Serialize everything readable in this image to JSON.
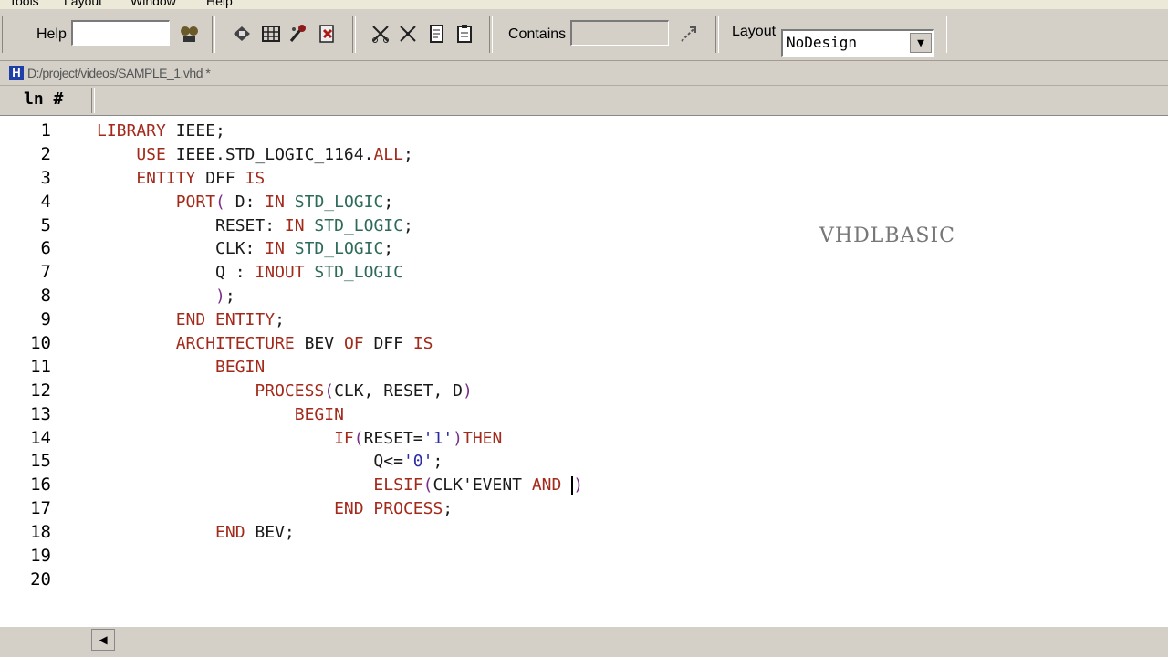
{
  "menu": [
    "Tools",
    "Layout",
    "Window",
    "Help"
  ],
  "toolbar": {
    "help_label": "Help",
    "help_value": "",
    "contains_label": "Contains",
    "contains_value": "",
    "layout_label": "Layout",
    "layout_value": "NoDesign"
  },
  "document": {
    "path": "D:/project/videos/SAMPLE_1.vhd *"
  },
  "ruler": {
    "ln_label": "ln #"
  },
  "line_numbers": [
    "1",
    "2",
    "3",
    "4",
    "5",
    "6",
    "7",
    "8",
    "9",
    "10",
    "11",
    "12",
    "13",
    "14",
    "15",
    "16",
    "17",
    "18",
    "19",
    "20"
  ],
  "code": [
    [
      {
        "t": "LIBRARY",
        "c": "kw"
      },
      {
        "t": " IEEE;",
        "c": "id"
      }
    ],
    [
      {
        "t": "    USE",
        "c": "kw"
      },
      {
        "t": " IEEE.STD_LOGIC_1164.",
        "c": "id"
      },
      {
        "t": "ALL",
        "c": "kw"
      },
      {
        "t": ";",
        "c": "id"
      }
    ],
    [
      {
        "t": "    ENTITY",
        "c": "kw"
      },
      {
        "t": " DFF ",
        "c": "id"
      },
      {
        "t": "IS",
        "c": "kw"
      }
    ],
    [
      {
        "t": "        PORT",
        "c": "kw"
      },
      {
        "t": "(",
        "c": "pn"
      },
      {
        "t": " D: ",
        "c": "id"
      },
      {
        "t": "IN",
        "c": "kw"
      },
      {
        "t": " STD_LOGIC",
        "c": "tp"
      },
      {
        "t": ";",
        "c": "id"
      }
    ],
    [
      {
        "t": "            RESET: ",
        "c": "id"
      },
      {
        "t": "IN",
        "c": "kw"
      },
      {
        "t": " STD_LOGIC",
        "c": "tp"
      },
      {
        "t": ";",
        "c": "id"
      }
    ],
    [
      {
        "t": "            CLK: ",
        "c": "id"
      },
      {
        "t": "IN",
        "c": "kw"
      },
      {
        "t": " STD_LOGIC",
        "c": "tp"
      },
      {
        "t": ";",
        "c": "id"
      }
    ],
    [
      {
        "t": "            Q : ",
        "c": "id"
      },
      {
        "t": "INOUT",
        "c": "kw"
      },
      {
        "t": " STD_LOGIC",
        "c": "tp"
      }
    ],
    [
      {
        "t": "            )",
        "c": "pn"
      },
      {
        "t": ";",
        "c": "id"
      }
    ],
    [
      {
        "t": "        END ENTITY",
        "c": "kw"
      },
      {
        "t": ";",
        "c": "id"
      }
    ],
    [
      {
        "t": "        ARCHITECTURE",
        "c": "kw"
      },
      {
        "t": " BEV ",
        "c": "id"
      },
      {
        "t": "OF",
        "c": "kw"
      },
      {
        "t": " DFF ",
        "c": "id"
      },
      {
        "t": "IS",
        "c": "kw"
      }
    ],
    [
      {
        "t": "            BEGIN",
        "c": "kw"
      }
    ],
    [
      {
        "t": "                PROCESS",
        "c": "kw"
      },
      {
        "t": "(",
        "c": "pn"
      },
      {
        "t": "CLK, RESET, D",
        "c": "id"
      },
      {
        "t": ")",
        "c": "pn"
      }
    ],
    [
      {
        "t": "                    BEGIN",
        "c": "kw"
      }
    ],
    [
      {
        "t": "                        IF",
        "c": "kw"
      },
      {
        "t": "(",
        "c": "pn"
      },
      {
        "t": "RESET=",
        "c": "id"
      },
      {
        "t": "'1'",
        "c": "lit"
      },
      {
        "t": ")",
        "c": "pn"
      },
      {
        "t": "THEN",
        "c": "kw"
      }
    ],
    [
      {
        "t": "                            Q<=",
        "c": "id"
      },
      {
        "t": "'0'",
        "c": "lit"
      },
      {
        "t": ";",
        "c": "id"
      }
    ],
    [
      {
        "t": "                            ELSIF",
        "c": "kw"
      },
      {
        "t": "(",
        "c": "pn"
      },
      {
        "t": "CLK'EVENT ",
        "c": "id"
      },
      {
        "t": "AND",
        "c": "kw"
      },
      {
        "t": " ",
        "c": "id"
      },
      {
        "t": "|",
        "c": "cursor"
      },
      {
        "t": ")",
        "c": "pn"
      }
    ],
    [
      {
        "t": "                        END PROCESS",
        "c": "kw"
      },
      {
        "t": ";",
        "c": "id"
      }
    ],
    [
      {
        "t": "            END",
        "c": "kw"
      },
      {
        "t": " BEV;",
        "c": "id"
      }
    ],
    [],
    []
  ],
  "watermark": "VHDLBASIC"
}
